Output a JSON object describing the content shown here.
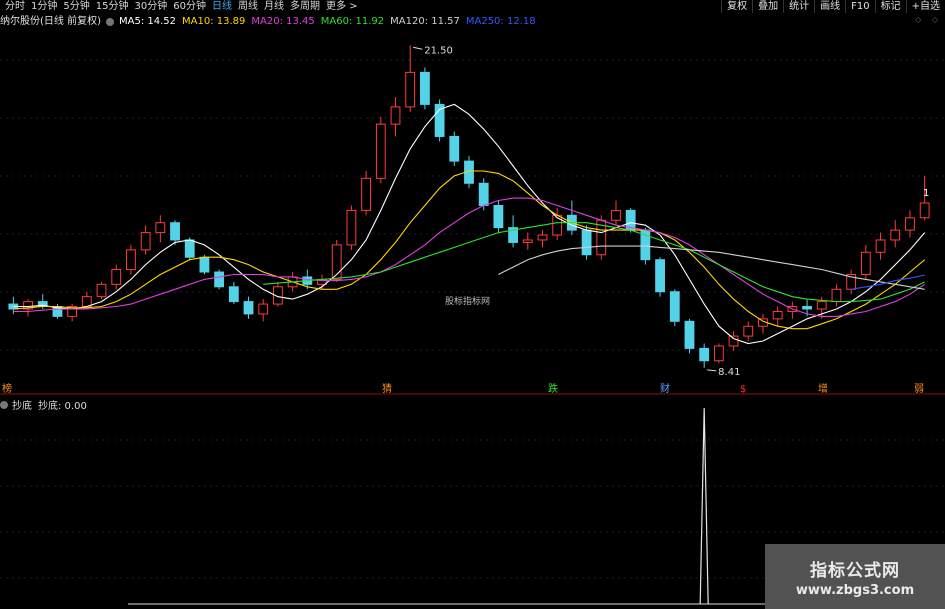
{
  "periods": [
    "分时",
    "1分钟",
    "5分钟",
    "15分钟",
    "30分钟",
    "60分钟",
    "日线",
    "周线",
    "月线",
    "多周期",
    "更多 >"
  ],
  "active_period": "日线",
  "tools": [
    "复权",
    "叠加",
    "统计",
    "画线",
    "F10",
    "标记",
    "+自选"
  ],
  "stock_title": "纳尔股份(日线 前复权)",
  "ma_legend": [
    {
      "label": "MA5: 14.52",
      "color": "#ffffff"
    },
    {
      "label": "MA10: 13.89",
      "color": "#ffd700"
    },
    {
      "label": "MA20: 13.45",
      "color": "#e040e0"
    },
    {
      "label": "MA60: 11.92",
      "color": "#30e030"
    },
    {
      "label": "MA120: 11.57",
      "color": "#d0d0d0"
    },
    {
      "label": "MA250: 12.18",
      "color": "#3355ff"
    }
  ],
  "annotations": {
    "high": "21.50",
    "low": "8.41",
    "center_label": "股标指标网",
    "signal_left": "榜",
    "signal_1": "猜",
    "signal_2": "跌",
    "signal_3": "财",
    "signal_4": "$",
    "signal_5": "增",
    "signal_6": "弱",
    "right_edge": "1"
  },
  "sub_indicator": {
    "title": "抄底",
    "value_label": "抄底: 0.00"
  },
  "watermark": {
    "title": "指标公式网",
    "url": "www.zbgs3.com"
  },
  "colors": {
    "up": "#ff3b3b",
    "down": "#54d2e8",
    "ma5": "#ffffff",
    "ma10": "#ffd700",
    "ma20": "#e040e0",
    "ma60": "#30e030",
    "ma120": "#d0d0d0",
    "ma250": "#3355ff"
  },
  "chart_data": {
    "type": "candlestick",
    "series_points": [
      {
        "o": 11.0,
        "h": 11.3,
        "l": 10.6,
        "c": 10.8
      },
      {
        "o": 10.8,
        "h": 11.2,
        "l": 10.5,
        "c": 11.1
      },
      {
        "o": 11.1,
        "h": 11.4,
        "l": 10.8,
        "c": 10.9
      },
      {
        "o": 10.9,
        "h": 11.0,
        "l": 10.4,
        "c": 10.5
      },
      {
        "o": 10.5,
        "h": 11.0,
        "l": 10.3,
        "c": 10.9
      },
      {
        "o": 10.9,
        "h": 11.5,
        "l": 10.8,
        "c": 11.3
      },
      {
        "o": 11.3,
        "h": 11.9,
        "l": 11.2,
        "c": 11.8
      },
      {
        "o": 11.8,
        "h": 12.6,
        "l": 11.6,
        "c": 12.4
      },
      {
        "o": 12.4,
        "h": 13.4,
        "l": 12.2,
        "c": 13.2
      },
      {
        "o": 13.2,
        "h": 14.2,
        "l": 13.0,
        "c": 13.9
      },
      {
        "o": 13.9,
        "h": 14.6,
        "l": 13.5,
        "c": 14.3
      },
      {
        "o": 14.3,
        "h": 14.4,
        "l": 13.4,
        "c": 13.6
      },
      {
        "o": 13.6,
        "h": 13.7,
        "l": 12.8,
        "c": 12.9
      },
      {
        "o": 12.9,
        "h": 13.0,
        "l": 12.2,
        "c": 12.3
      },
      {
        "o": 12.3,
        "h": 12.4,
        "l": 11.6,
        "c": 11.7
      },
      {
        "o": 11.7,
        "h": 11.9,
        "l": 11.0,
        "c": 11.1
      },
      {
        "o": 11.1,
        "h": 11.3,
        "l": 10.4,
        "c": 10.6
      },
      {
        "o": 10.6,
        "h": 11.2,
        "l": 10.3,
        "c": 11.0
      },
      {
        "o": 11.0,
        "h": 11.9,
        "l": 10.9,
        "c": 11.7
      },
      {
        "o": 11.7,
        "h": 12.3,
        "l": 11.5,
        "c": 12.1
      },
      {
        "o": 12.1,
        "h": 12.4,
        "l": 11.6,
        "c": 11.8
      },
      {
        "o": 11.8,
        "h": 12.2,
        "l": 11.6,
        "c": 12.0
      },
      {
        "o": 12.0,
        "h": 13.6,
        "l": 11.9,
        "c": 13.4
      },
      {
        "o": 13.4,
        "h": 15.0,
        "l": 13.2,
        "c": 14.8
      },
      {
        "o": 14.8,
        "h": 16.4,
        "l": 14.6,
        "c": 16.1
      },
      {
        "o": 16.1,
        "h": 18.6,
        "l": 15.9,
        "c": 18.3
      },
      {
        "o": 18.3,
        "h": 19.4,
        "l": 17.8,
        "c": 19.0
      },
      {
        "o": 19.0,
        "h": 21.5,
        "l": 18.8,
        "c": 20.4
      },
      {
        "o": 20.4,
        "h": 20.6,
        "l": 18.9,
        "c": 19.1
      },
      {
        "o": 19.1,
        "h": 19.3,
        "l": 17.6,
        "c": 17.8
      },
      {
        "o": 17.8,
        "h": 18.0,
        "l": 16.6,
        "c": 16.8
      },
      {
        "o": 16.8,
        "h": 17.0,
        "l": 15.7,
        "c": 15.9
      },
      {
        "o": 15.9,
        "h": 16.1,
        "l": 14.8,
        "c": 15.0
      },
      {
        "o": 15.0,
        "h": 15.2,
        "l": 13.9,
        "c": 14.1
      },
      {
        "o": 14.1,
        "h": 14.6,
        "l": 13.3,
        "c": 13.5
      },
      {
        "o": 13.5,
        "h": 13.9,
        "l": 13.2,
        "c": 13.6
      },
      {
        "o": 13.6,
        "h": 14.0,
        "l": 13.3,
        "c": 13.8
      },
      {
        "o": 13.8,
        "h": 14.9,
        "l": 13.6,
        "c": 14.6
      },
      {
        "o": 14.6,
        "h": 15.2,
        "l": 13.8,
        "c": 14.0
      },
      {
        "o": 14.0,
        "h": 14.2,
        "l": 12.8,
        "c": 13.0
      },
      {
        "o": 13.0,
        "h": 14.6,
        "l": 12.8,
        "c": 14.4
      },
      {
        "o": 14.4,
        "h": 15.2,
        "l": 14.2,
        "c": 14.8
      },
      {
        "o": 14.8,
        "h": 14.9,
        "l": 13.9,
        "c": 14.0
      },
      {
        "o": 14.0,
        "h": 14.1,
        "l": 12.6,
        "c": 12.8
      },
      {
        "o": 12.8,
        "h": 12.9,
        "l": 11.3,
        "c": 11.5
      },
      {
        "o": 11.5,
        "h": 11.6,
        "l": 10.1,
        "c": 10.3
      },
      {
        "o": 10.3,
        "h": 10.4,
        "l": 9.0,
        "c": 9.2
      },
      {
        "o": 9.2,
        "h": 9.4,
        "l": 8.41,
        "c": 8.7
      },
      {
        "o": 8.7,
        "h": 9.4,
        "l": 8.6,
        "c": 9.3
      },
      {
        "o": 9.3,
        "h": 9.9,
        "l": 9.1,
        "c": 9.7
      },
      {
        "o": 9.7,
        "h": 10.3,
        "l": 9.5,
        "c": 10.1
      },
      {
        "o": 10.1,
        "h": 10.6,
        "l": 9.8,
        "c": 10.4
      },
      {
        "o": 10.4,
        "h": 10.9,
        "l": 10.1,
        "c": 10.7
      },
      {
        "o": 10.7,
        "h": 11.1,
        "l": 10.4,
        "c": 10.9
      },
      {
        "o": 10.9,
        "h": 11.2,
        "l": 10.5,
        "c": 10.8
      },
      {
        "o": 10.8,
        "h": 11.3,
        "l": 10.4,
        "c": 11.1
      },
      {
        "o": 11.1,
        "h": 11.8,
        "l": 10.9,
        "c": 11.6
      },
      {
        "o": 11.6,
        "h": 12.4,
        "l": 11.4,
        "c": 12.2
      },
      {
        "o": 12.2,
        "h": 13.4,
        "l": 12.0,
        "c": 13.1
      },
      {
        "o": 13.1,
        "h": 13.9,
        "l": 12.8,
        "c": 13.6
      },
      {
        "o": 13.6,
        "h": 14.4,
        "l": 13.3,
        "c": 14.0
      },
      {
        "o": 14.0,
        "h": 14.8,
        "l": 13.7,
        "c": 14.5
      },
      {
        "o": 14.5,
        "h": 16.2,
        "l": 14.4,
        "c": 15.1
      }
    ],
    "ma_lines": [
      {
        "name": "MA5",
        "values": [
          10.9,
          10.9,
          10.95,
          10.85,
          10.8,
          10.9,
          11.1,
          11.5,
          12.0,
          12.6,
          13.1,
          13.5,
          13.6,
          13.4,
          13.0,
          12.5,
          12.0,
          11.6,
          11.3,
          11.2,
          11.4,
          11.7,
          12.2,
          12.8,
          13.6,
          14.8,
          16.1,
          17.3,
          18.2,
          18.9,
          19.1,
          18.7,
          18.1,
          17.4,
          16.6,
          15.8,
          15.1,
          14.5,
          14.2,
          14.0,
          13.9,
          14.1,
          14.3,
          14.2,
          13.8,
          13.0,
          12.0,
          11.0,
          10.1,
          9.6,
          9.4,
          9.5,
          9.8,
          10.1,
          10.4,
          10.6,
          10.8,
          11.1,
          11.5,
          12.0,
          12.6,
          13.2,
          13.9
        ]
      },
      {
        "name": "MA10",
        "values": [
          10.8,
          10.85,
          10.9,
          10.9,
          10.85,
          10.85,
          10.9,
          11.1,
          11.4,
          11.8,
          12.2,
          12.5,
          12.8,
          12.9,
          12.9,
          12.8,
          12.6,
          12.3,
          12.1,
          11.9,
          11.7,
          11.6,
          11.6,
          11.8,
          12.2,
          12.8,
          13.5,
          14.3,
          15.0,
          15.7,
          16.2,
          16.4,
          16.4,
          16.3,
          16.0,
          15.5,
          15.0,
          14.6,
          14.3,
          14.1,
          14.0,
          14.0,
          14.0,
          14.0,
          13.9,
          13.6,
          13.1,
          12.5,
          11.8,
          11.2,
          10.7,
          10.3,
          10.1,
          10.0,
          10.0,
          10.2,
          10.4,
          10.7,
          11.0,
          11.4,
          11.8,
          12.3,
          12.8
        ]
      },
      {
        "name": "MA20",
        "values": [
          10.7,
          10.7,
          10.75,
          10.8,
          10.8,
          10.8,
          10.85,
          10.9,
          11.0,
          11.2,
          11.4,
          11.6,
          11.8,
          12.0,
          12.1,
          12.2,
          12.2,
          12.2,
          12.1,
          12.1,
          12.0,
          11.95,
          11.95,
          12.0,
          12.1,
          12.3,
          12.6,
          13.0,
          13.4,
          13.9,
          14.3,
          14.7,
          15.0,
          15.2,
          15.3,
          15.3,
          15.2,
          15.0,
          14.8,
          14.6,
          14.4,
          14.2,
          14.1,
          14.0,
          13.9,
          13.7,
          13.4,
          13.0,
          12.6,
          12.2,
          11.8,
          11.4,
          11.1,
          10.8,
          10.6,
          10.5,
          10.5,
          10.6,
          10.7,
          10.9,
          11.1,
          11.4,
          11.8
        ]
      },
      {
        "name": "MA60",
        "values": [
          null,
          null,
          null,
          null,
          null,
          null,
          null,
          null,
          null,
          null,
          null,
          null,
          null,
          null,
          null,
          null,
          null,
          11.8,
          11.85,
          11.9,
          11.95,
          12.0,
          12.05,
          12.1,
          12.2,
          12.3,
          12.5,
          12.7,
          12.9,
          13.1,
          13.3,
          13.5,
          13.7,
          13.9,
          14.0,
          14.1,
          14.2,
          14.3,
          14.3,
          14.3,
          14.2,
          14.1,
          14.0,
          13.8,
          13.6,
          13.4,
          13.2,
          12.9,
          12.6,
          12.3,
          12.0,
          11.7,
          11.5,
          11.3,
          11.2,
          11.15,
          11.1,
          11.1,
          11.15,
          11.2,
          11.4,
          11.6,
          11.9
        ]
      },
      {
        "name": "MA120",
        "values": [
          null,
          null,
          null,
          null,
          null,
          null,
          null,
          null,
          null,
          null,
          null,
          null,
          null,
          null,
          null,
          null,
          null,
          null,
          null,
          null,
          null,
          null,
          null,
          null,
          null,
          null,
          null,
          null,
          null,
          null,
          null,
          null,
          null,
          12.2,
          12.5,
          12.8,
          13.0,
          13.15,
          13.25,
          13.3,
          13.35,
          13.35,
          13.35,
          13.35,
          13.3,
          13.25,
          13.2,
          13.15,
          13.1,
          13.0,
          12.9,
          12.8,
          12.7,
          12.6,
          12.5,
          12.4,
          12.25,
          12.1,
          12.0,
          11.9,
          11.8,
          11.7,
          11.6
        ]
      },
      {
        "name": "MA250",
        "values": [
          null,
          null,
          null,
          null,
          null,
          null,
          null,
          null,
          null,
          null,
          null,
          null,
          null,
          null,
          null,
          null,
          null,
          null,
          null,
          null,
          null,
          null,
          null,
          null,
          null,
          null,
          null,
          null,
          null,
          null,
          null,
          null,
          null,
          null,
          null,
          null,
          null,
          null,
          null,
          null,
          null,
          null,
          null,
          null,
          null,
          null,
          null,
          null,
          null,
          null,
          null,
          null,
          null,
          null,
          null,
          null,
          null,
          11.6,
          11.7,
          11.8,
          11.95,
          12.05,
          12.18
        ]
      }
    ],
    "y_range": [
      8.0,
      22.2
    ],
    "sub_signal_index": 47,
    "sub_values_note": "single spike at low point, otherwise 0"
  }
}
